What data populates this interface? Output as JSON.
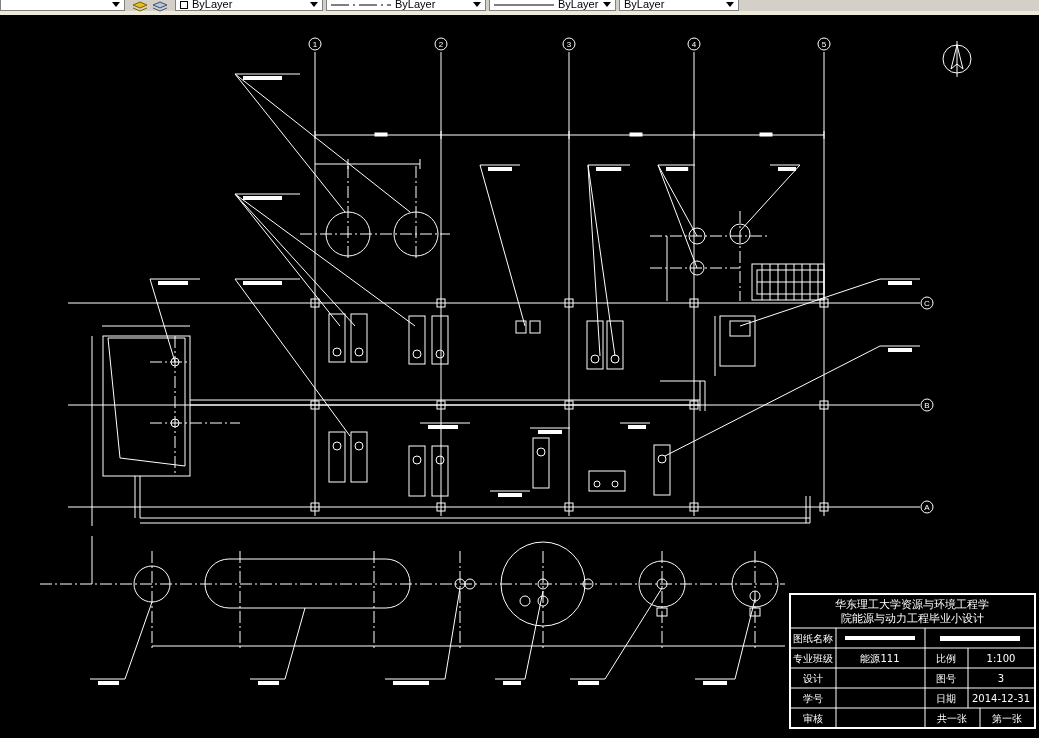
{
  "toolbar": {
    "dropdowns": [
      {
        "kind": "layer"
      },
      {
        "kind": "color",
        "value": "ByLayer"
      },
      {
        "kind": "linetype",
        "value": "ByLayer"
      },
      {
        "kind": "lineweight",
        "value": "ByLayer"
      },
      {
        "kind": "plotstyle",
        "value": "ByLayer"
      }
    ]
  },
  "drawing": {
    "column_axes": [
      "1",
      "2",
      "3",
      "4",
      "5"
    ],
    "row_axes": [
      "C",
      "B",
      "A"
    ],
    "title_block": {
      "title": "华东理工大学资源与环境工程学院能源与动力工程毕业小设计",
      "rows": [
        {
          "label": "图纸名称",
          "cells": []
        },
        {
          "label": "专业班级",
          "cells": [
            "能源111",
            "比例",
            "1:100"
          ]
        },
        {
          "label": "设计",
          "cells": [
            "",
            "图号",
            "3"
          ]
        },
        {
          "label": "学号",
          "cells": [
            "",
            "日期",
            "2014-12-31"
          ]
        },
        {
          "label": "审核",
          "cells": [
            "",
            "共一张",
            "第一张"
          ]
        }
      ]
    }
  }
}
